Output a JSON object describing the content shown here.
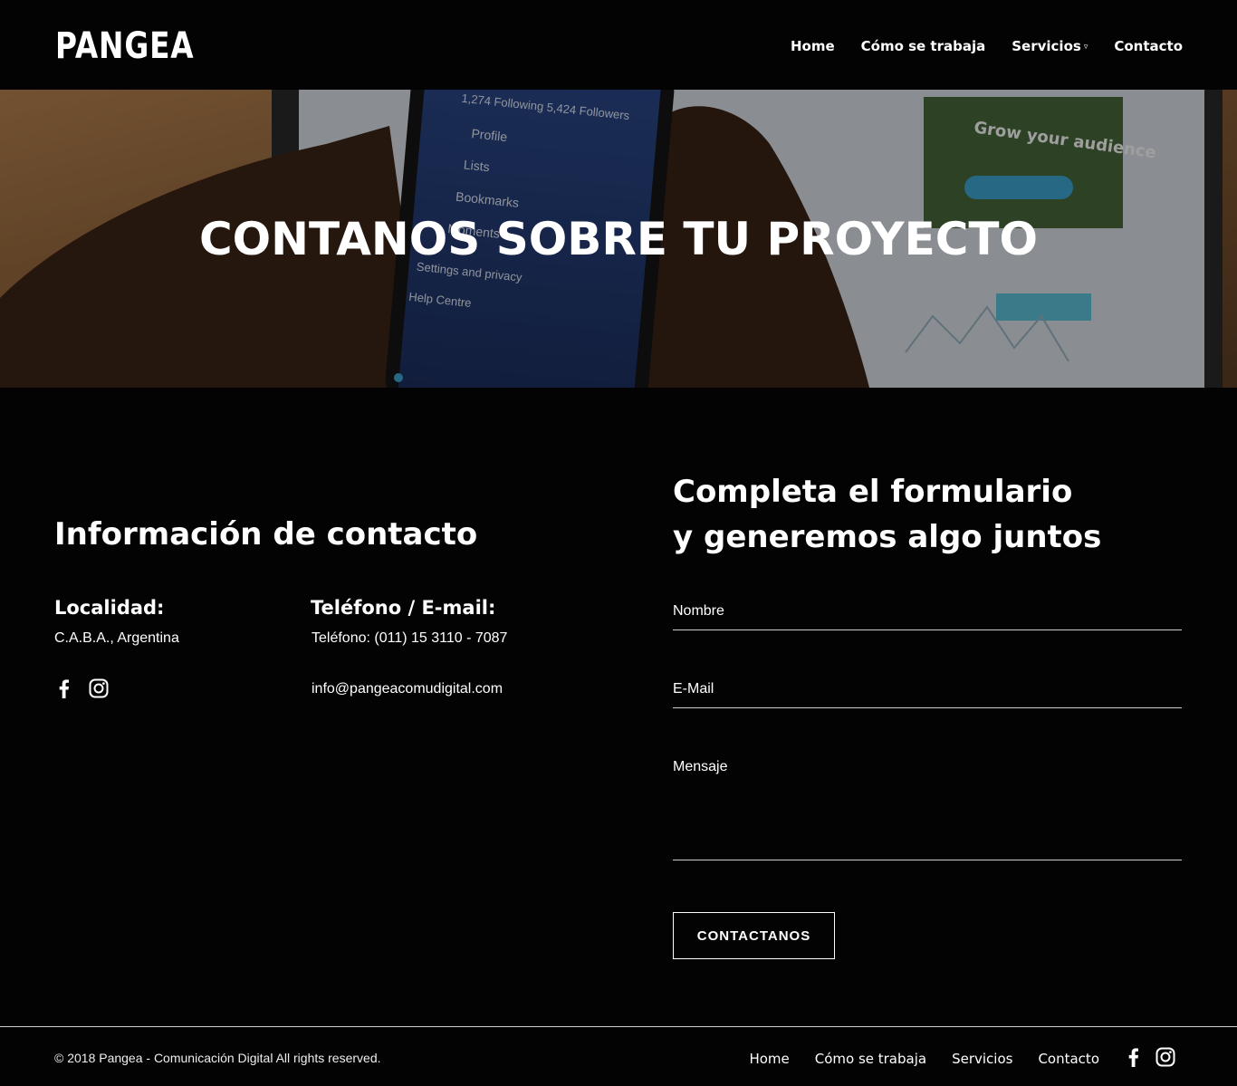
{
  "header": {
    "logo": "PANGEA",
    "nav": [
      {
        "label": "Home"
      },
      {
        "label": "Cómo se trabaja"
      },
      {
        "label": "Servicios"
      },
      {
        "label": "Contacto"
      }
    ]
  },
  "hero": {
    "title": "CONTANOS SOBRE TU PROYECTO",
    "phone_menu": [
      "1,274 Following  5,424 Followers",
      "Profile",
      "Lists",
      "Bookmarks",
      "Moments",
      "Settings and privacy",
      "Help Centre"
    ],
    "laptop_card": "Grow your audience"
  },
  "contact_info": {
    "heading": "Información de contacto",
    "location_label": "Localidad:",
    "location_value": "C.A.B.A., Argentina",
    "phone_label": "Teléfono / E-mail:",
    "phone_value": "Teléfono: (011) 15 3110 - 7087",
    "email_value": "info@pangeacomudigital.com",
    "social_icons": [
      "facebook-icon",
      "instagram-icon"
    ]
  },
  "form": {
    "heading_line1": "Completa el formulario",
    "heading_line2": "y generemos algo juntos",
    "name_label": "Nombre",
    "email_label": "E-Mail",
    "message_label": "Mensaje",
    "submit_label": "CONTACTANOS"
  },
  "footer": {
    "copyright": "© 2018 Pangea - Comunicación Digital All rights reserved.",
    "nav": [
      {
        "label": "Home"
      },
      {
        "label": "Cómo se trabaja"
      },
      {
        "label": "Servicios"
      },
      {
        "label": "Contacto"
      }
    ],
    "social_icons": [
      "facebook-icon",
      "instagram-icon"
    ]
  }
}
